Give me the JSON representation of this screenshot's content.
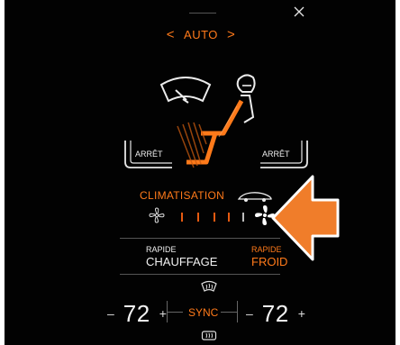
{
  "climate": {
    "mode_label": "AUTO",
    "prev_arrow": "<",
    "next_arrow": ">",
    "seat_left_label": "ARRÊT",
    "seat_right_label": "ARRÊT",
    "climatisation_label": "CLIMATISATION",
    "fan_level": 0.8,
    "fast_heat_small": "RAPIDE",
    "fast_heat_big": "CHAUFFAGE",
    "fast_cool_small": "RAPIDE",
    "fast_cool_big": "FROID",
    "left_minus": "–",
    "left_temp": "72",
    "left_plus": "+",
    "sync_label": "SYNC",
    "right_minus": "–",
    "right_temp": "72",
    "right_plus": "+"
  },
  "colors": {
    "accent": "#ff7a1a",
    "background": "#020202",
    "callout_arrow": "#f07d2a"
  },
  "icons": [
    "close-icon",
    "windshield-icon",
    "driver-icon",
    "seat-icon",
    "car-icon",
    "fan-low-icon",
    "fan-high-icon",
    "rear-defrost-icon",
    "front-defrost-icon",
    "callout-arrow"
  ]
}
